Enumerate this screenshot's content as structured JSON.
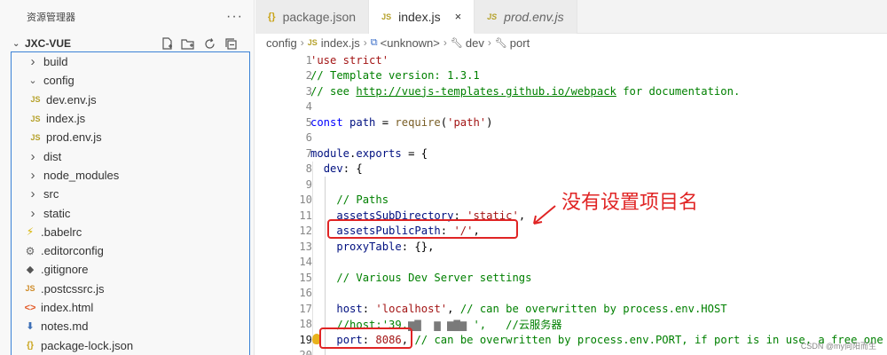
{
  "sidebar": {
    "header": "资源管理器",
    "more": "···",
    "project": "JXC-VUE",
    "actions": [
      "new-file-icon",
      "new-folder-icon",
      "refresh-icon",
      "collapse-all-icon"
    ],
    "items": [
      {
        "label": "build",
        "type": "folder",
        "expanded": false,
        "depth": 0
      },
      {
        "label": "config",
        "type": "folder",
        "expanded": true,
        "depth": 0
      },
      {
        "label": "dev.env.js",
        "type": "js",
        "depth": 1
      },
      {
        "label": "index.js",
        "type": "js",
        "depth": 1
      },
      {
        "label": "prod.env.js",
        "type": "js",
        "depth": 1
      },
      {
        "label": "dist",
        "type": "folder",
        "expanded": false,
        "depth": 0
      },
      {
        "label": "node_modules",
        "type": "folder",
        "expanded": false,
        "depth": 0
      },
      {
        "label": "src",
        "type": "folder",
        "expanded": false,
        "depth": 0
      },
      {
        "label": "static",
        "type": "folder",
        "expanded": false,
        "depth": 0
      },
      {
        "label": ".babelrc",
        "type": "babel",
        "depth": 0
      },
      {
        "label": ".editorconfig",
        "type": "gear",
        "depth": 0
      },
      {
        "label": ".gitignore",
        "type": "git",
        "depth": 0
      },
      {
        "label": ".postcssrc.js",
        "type": "js-orange",
        "depth": 0
      },
      {
        "label": "index.html",
        "type": "html",
        "depth": 0
      },
      {
        "label": "notes.md",
        "type": "md",
        "depth": 0
      },
      {
        "label": "package-lock.json",
        "type": "json",
        "depth": 0
      }
    ]
  },
  "tabs": [
    {
      "label": "package.json",
      "icon": "{}",
      "active": false,
      "italic": false
    },
    {
      "label": "index.js",
      "icon": "JS",
      "active": true,
      "italic": false,
      "close": "×"
    },
    {
      "label": "prod.env.js",
      "icon": "JS",
      "active": false,
      "italic": true
    }
  ],
  "breadcrumb": {
    "folder": "config",
    "file": "index.js",
    "symbol1": "<unknown>",
    "symbol2": "dev",
    "symbol3": "port"
  },
  "editor": {
    "current_line": 19,
    "lines": [
      {
        "n": "1",
        "tokens": [
          {
            "t": "str",
            "v": "'use strict'"
          }
        ]
      },
      {
        "n": "2",
        "tokens": [
          {
            "t": "com",
            "v": "// Template version: 1.3.1"
          }
        ]
      },
      {
        "n": "3",
        "tokens": [
          {
            "t": "com",
            "v": "// see "
          },
          {
            "t": "link",
            "v": "http://vuejs-templates.github.io/webpack"
          },
          {
            "t": "com",
            "v": " for documentation."
          }
        ]
      },
      {
        "n": "4",
        "tokens": []
      },
      {
        "n": "5",
        "tokens": [
          {
            "t": "kw",
            "v": "const "
          },
          {
            "t": "var",
            "v": "path"
          },
          {
            "t": "op",
            "v": " = "
          },
          {
            "t": "fn",
            "v": "require"
          },
          {
            "t": "op",
            "v": "("
          },
          {
            "t": "str",
            "v": "'path'"
          },
          {
            "t": "op",
            "v": ")"
          }
        ]
      },
      {
        "n": "6",
        "tokens": []
      },
      {
        "n": "7",
        "tokens": [
          {
            "t": "var",
            "v": "module"
          },
          {
            "t": "op",
            "v": "."
          },
          {
            "t": "var",
            "v": "exports"
          },
          {
            "t": "op",
            "v": " = {"
          }
        ]
      },
      {
        "n": "8",
        "tokens": [
          {
            "t": "op",
            "v": "  "
          },
          {
            "t": "var",
            "v": "dev"
          },
          {
            "t": "op",
            "v": ": {"
          }
        ]
      },
      {
        "n": "9",
        "tokens": []
      },
      {
        "n": "10",
        "tokens": [
          {
            "t": "op",
            "v": "    "
          },
          {
            "t": "com",
            "v": "// Paths"
          }
        ]
      },
      {
        "n": "11",
        "tokens": [
          {
            "t": "op",
            "v": "    "
          },
          {
            "t": "var",
            "v": "assetsSubDirectory"
          },
          {
            "t": "op",
            "v": ": "
          },
          {
            "t": "str",
            "v": "'static'"
          },
          {
            "t": "op",
            "v": ","
          }
        ]
      },
      {
        "n": "12",
        "tokens": [
          {
            "t": "op",
            "v": "    "
          },
          {
            "t": "var",
            "v": "assetsPublicPath"
          },
          {
            "t": "op",
            "v": ": "
          },
          {
            "t": "str",
            "v": "'/'"
          },
          {
            "t": "op",
            "v": ","
          }
        ]
      },
      {
        "n": "13",
        "tokens": [
          {
            "t": "op",
            "v": "    "
          },
          {
            "t": "var",
            "v": "proxyTable"
          },
          {
            "t": "op",
            "v": ": {},"
          }
        ]
      },
      {
        "n": "14",
        "tokens": []
      },
      {
        "n": "15",
        "tokens": [
          {
            "t": "op",
            "v": "    "
          },
          {
            "t": "com",
            "v": "// Various Dev Server settings"
          }
        ]
      },
      {
        "n": "16",
        "tokens": []
      },
      {
        "n": "17",
        "tokens": [
          {
            "t": "op",
            "v": "    "
          },
          {
            "t": "var",
            "v": "host"
          },
          {
            "t": "op",
            "v": ": "
          },
          {
            "t": "str",
            "v": "'localhost'"
          },
          {
            "t": "op",
            "v": ", "
          },
          {
            "t": "com",
            "v": "// can be overwritten by process.env.HOST"
          }
        ]
      },
      {
        "n": "18",
        "tokens": [
          {
            "t": "op",
            "v": "    "
          },
          {
            "t": "com",
            "v": "//host:'39."
          },
          {
            "t": "blur",
            "v": "▆▇  ▆ ▆▇▆ "
          },
          {
            "t": "com",
            "v": "',   //云服务器"
          }
        ]
      },
      {
        "n": "19",
        "tokens": [
          {
            "t": "op",
            "v": "    "
          },
          {
            "t": "var",
            "v": "port"
          },
          {
            "t": "op",
            "v": ": "
          },
          {
            "t": "str",
            "v": "8086"
          },
          {
            "t": "op",
            "v": ", "
          },
          {
            "t": "com",
            "v": "// can be overwritten by process.env.PORT, if port is in use, a free one will"
          }
        ]
      },
      {
        "n": "20",
        "tokens": []
      }
    ]
  },
  "annotation": {
    "text": "没有设置项目名",
    "color": "#e02424"
  },
  "watermark": "CSDN @my向阳而生",
  "colors": {
    "accent_border": "#3b82d6",
    "annotation_red": "#e02424"
  }
}
